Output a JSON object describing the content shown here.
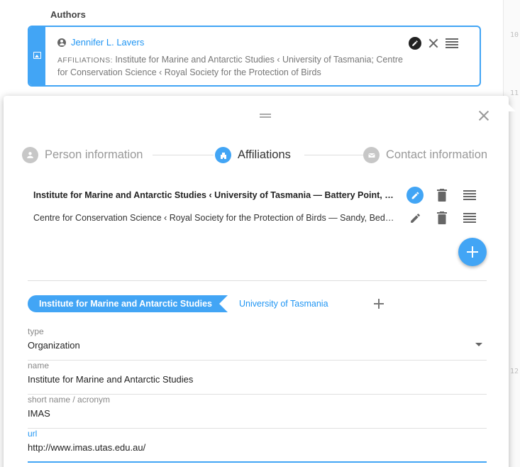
{
  "authors": {
    "title": "Authors",
    "card": {
      "name": "Jennifer L. Lavers",
      "affiliations_label": "AFFILIATIONS:",
      "affiliations_text": "Institute for Marine and Antarctic Studies ‹ University of Tasmania; Centre for Conservation Science ‹ Royal Society for the Protection of Birds"
    }
  },
  "gutter": {
    "line_numbers": [
      "10",
      "11",
      "12"
    ]
  },
  "modal": {
    "steps": [
      {
        "label": "Person information",
        "icon": "person-icon",
        "active": false
      },
      {
        "label": "Affiliations",
        "icon": "building-icon",
        "active": true
      },
      {
        "label": "Contact information",
        "icon": "mail-icon",
        "active": false
      }
    ],
    "affiliations": [
      {
        "text": "Institute for Marine and Antarctic Studies ‹ University of Tasmania — Battery Point, Tasmania, Australia",
        "selected": true
      },
      {
        "text": "Centre for Conservation Science ‹ Royal Society for the Protection of Birds — Sandy, Bedfordshire, United Kingdom",
        "selected": false
      }
    ],
    "breadcrumb": {
      "active": "Institute for Marine and Antarctic Studies",
      "parent": "University of Tasmania"
    },
    "form": {
      "type": {
        "label": "type",
        "value": "Organization"
      },
      "name": {
        "label": "name",
        "value": "Institute for Marine and Antarctic Studies"
      },
      "short_name": {
        "label": "short name / acronym",
        "value": "IMAS"
      },
      "url": {
        "label": "url",
        "value": "http://www.imas.utas.edu.au/"
      }
    }
  },
  "colors": {
    "accent": "#42a5f5",
    "link": "#2196f3"
  }
}
